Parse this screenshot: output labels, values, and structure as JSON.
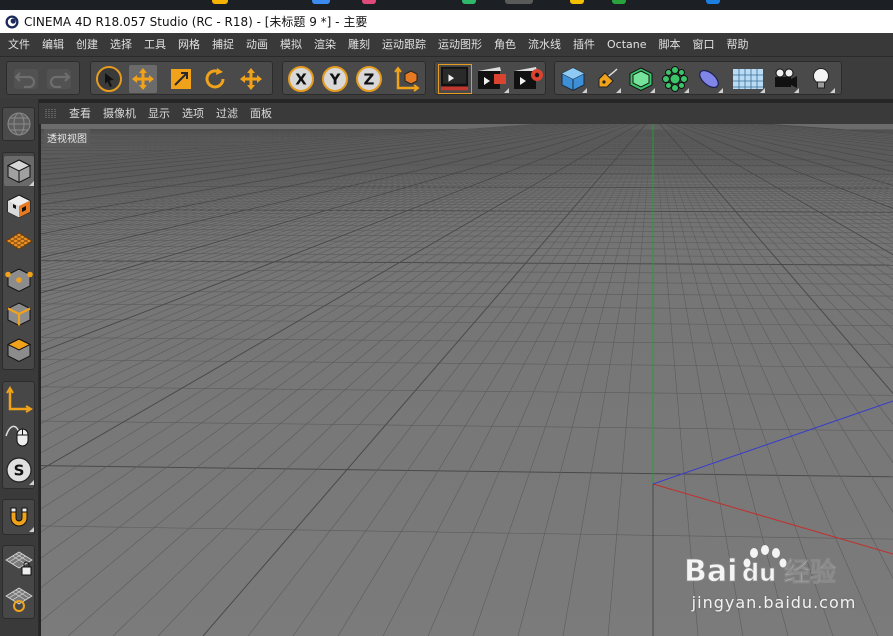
{
  "window": {
    "title": "CINEMA 4D R18.057 Studio (RC - R18) - [未标题 9 *] - 主要"
  },
  "menubar": {
    "items": [
      "文件",
      "编辑",
      "创建",
      "选择",
      "工具",
      "网格",
      "捕捉",
      "动画",
      "模拟",
      "渲染",
      "雕刻",
      "运动跟踪",
      "运动图形",
      "角色",
      "流水线",
      "插件",
      "Octane",
      "脚本",
      "窗口",
      "帮助"
    ]
  },
  "toolbar": {
    "undo": "undo-icon",
    "redo": "redo-icon",
    "axis_x": "X",
    "axis_y": "Y",
    "axis_z": "Z"
  },
  "viewport_menu": {
    "items": [
      "查看",
      "摄像机",
      "显示",
      "选项",
      "过滤",
      "面板"
    ]
  },
  "viewport": {
    "label": "透视视图",
    "axis_colors": {
      "x": "#c0312e",
      "y": "#2f9a3a",
      "z": "#3a3fc8"
    }
  },
  "watermark": {
    "brand": "Bai du 经验",
    "url": "jingyan.baidu.com"
  },
  "colors": {
    "accent_orange": "#e49b1f",
    "viewport_bg": "#797979",
    "ui_dark": "#393939"
  }
}
